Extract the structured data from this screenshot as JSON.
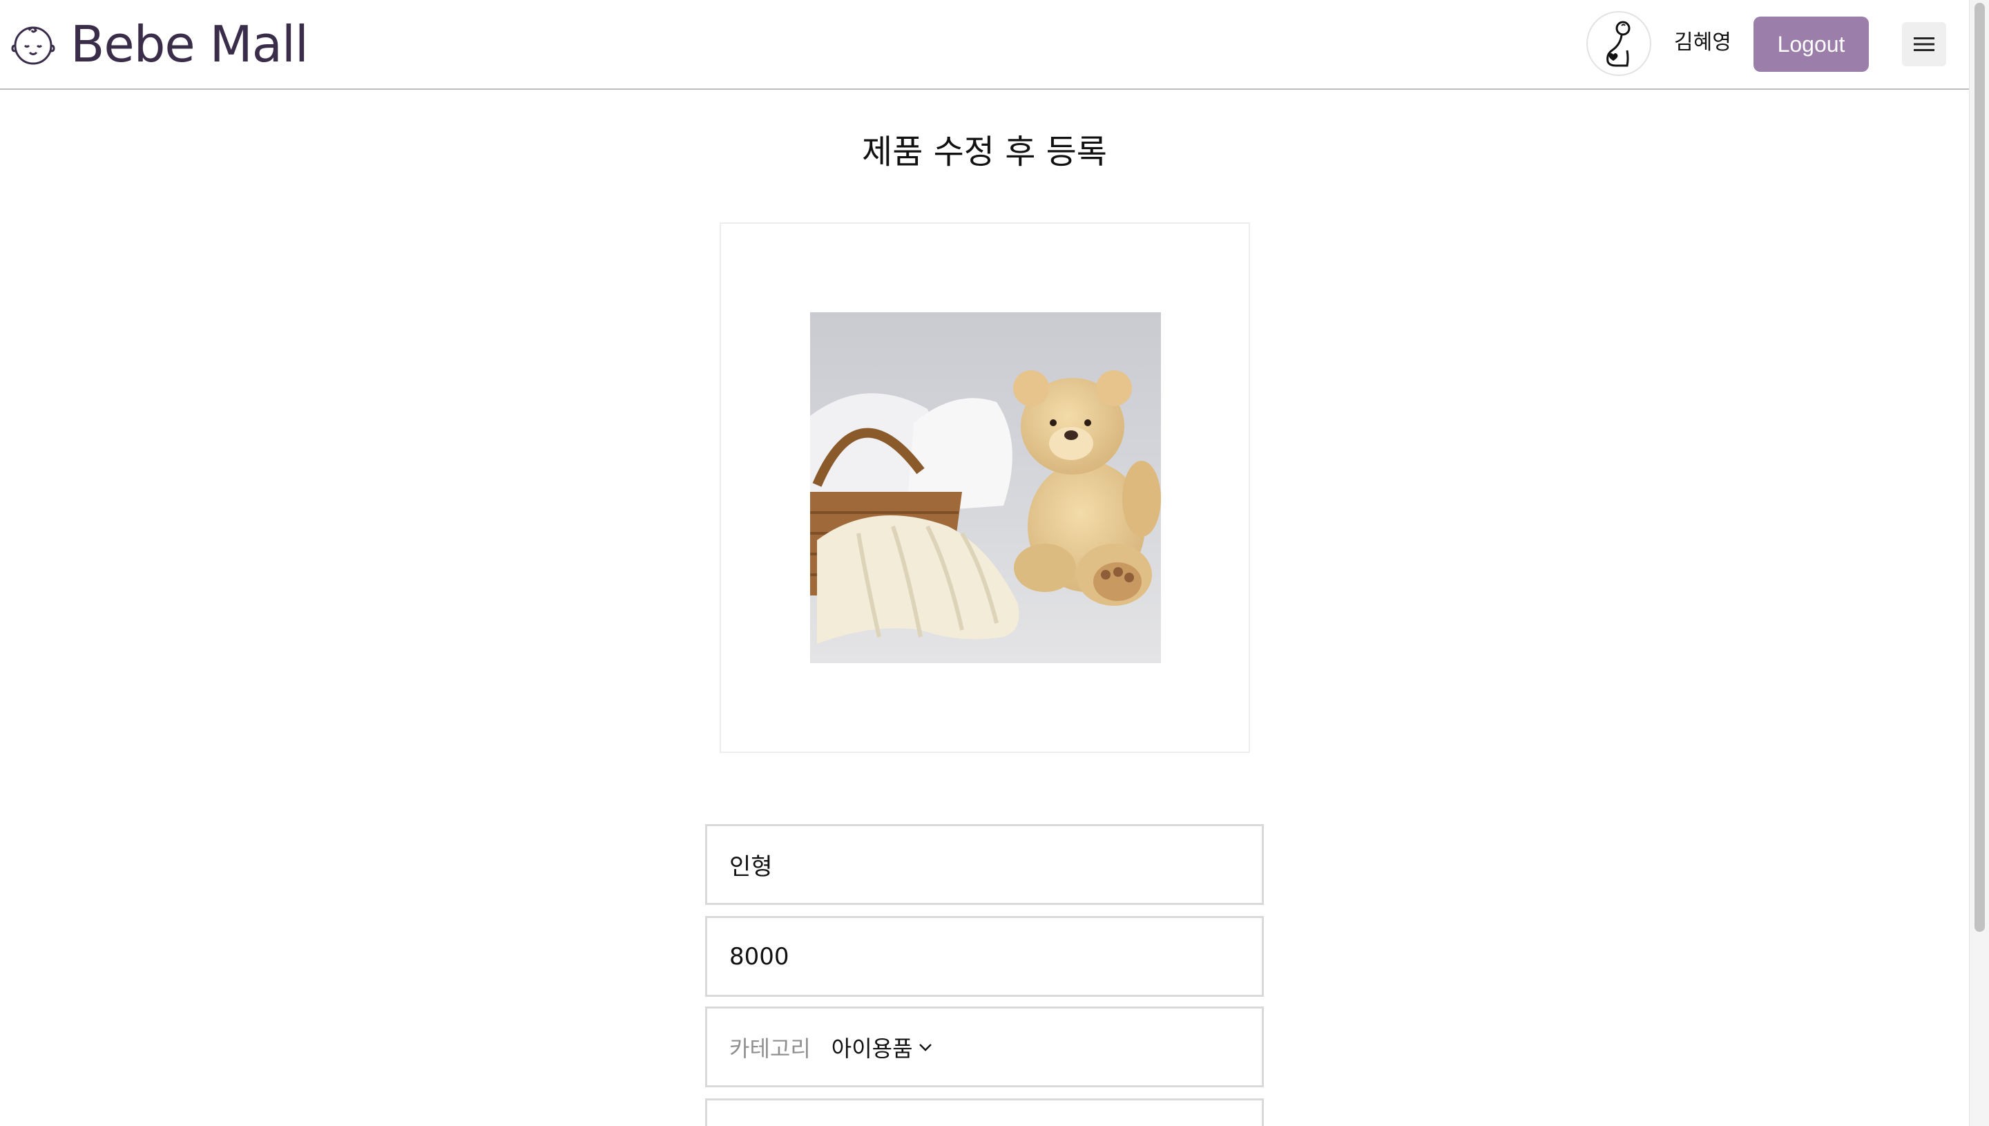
{
  "header": {
    "brand": "Bebe Mall",
    "logo_icon": "baby-face-icon",
    "avatar_icon": "baby-profile-icon",
    "username": "김혜영",
    "logout_label": "Logout",
    "menu_icon": "hamburger-icon",
    "accent_color": "#9b7eaa"
  },
  "main": {
    "title": "제품 수정 후 등록",
    "image_alt": "teddy-bear-blanket-basket-photo",
    "name_value": "인형",
    "price_value": "8000",
    "category_label": "카테고리",
    "category_value": "아이용품"
  }
}
